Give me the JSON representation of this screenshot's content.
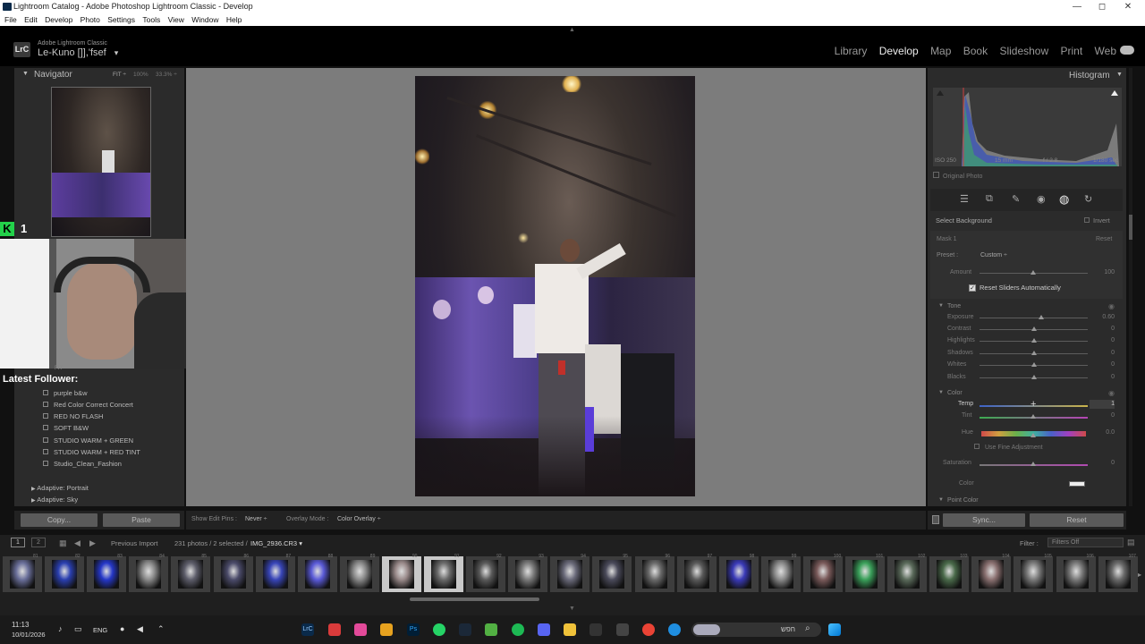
{
  "titlebar": {
    "title": "Lightroom Catalog - Adobe Photoshop Lightroom Classic - Develop",
    "min": "—",
    "max": "◻",
    "close": "✕"
  },
  "menubar": {
    "items": [
      "File",
      "Edit",
      "Develop",
      "Photo",
      "Settings",
      "Tools",
      "View",
      "Window",
      "Help"
    ]
  },
  "identity": {
    "logo": "LrC",
    "brand_top": "Adobe Lightroom Classic",
    "brand_name": "Le-Kuno []],'fsef",
    "dropdown": "▾",
    "modules": [
      "Library",
      "Develop",
      "Map",
      "Book",
      "Slideshow",
      "Print",
      "Web"
    ],
    "active_module": "Develop"
  },
  "navigator": {
    "title": "Navigator",
    "fit": "FIT ÷",
    "zoom1": "100%",
    "zoom2": "33.3% ÷"
  },
  "overlay": {
    "badge_k": "K",
    "badge_num": "1",
    "latest_follower": "Latest Follower:",
    "cut_label": "FIT"
  },
  "presets": {
    "items": [
      "purple b&w",
      "Red Color Correct Concert",
      "RED NO FLASH",
      "SOFT B&W",
      "STUDIO WARM + GREEN",
      "STUDIO WARM + RED TINT",
      "Studio_Clean_Fashion"
    ],
    "groups": [
      "Adaptive: Portrait",
      "Adaptive: Sky"
    ]
  },
  "left_buttons": {
    "copy": "Copy...",
    "paste": "Paste"
  },
  "toolbar": {
    "show_edit_pins_label": "Show Edit Pins :",
    "show_edit_pins_value": "Never ÷",
    "overlay_mode_label": "Overlay Mode :",
    "overlay_mode_value": "Color Overlay ÷"
  },
  "histogram": {
    "title": "Histogram",
    "iso": "ISO 250",
    "focal": "15 mm",
    "aperture": "f / 2.8",
    "shutter": "1/180 sec",
    "original_photo": "Original Photo"
  },
  "mask": {
    "select_label": "Select Background",
    "invert": "Invert",
    "mask_name": "Mask 1",
    "reset": "Reset",
    "preset_label": "Preset :",
    "preset_value": "Custom ÷",
    "amount_label": "Amount",
    "amount_value": "100",
    "reset_sliders": "Reset Sliders Automatically"
  },
  "tone": {
    "title": "Tone",
    "sliders": [
      {
        "label": "Exposure",
        "value": "0.60",
        "pos": 0.57
      },
      {
        "label": "Contrast",
        "value": "0",
        "pos": 0.5
      },
      {
        "label": "Highlights",
        "value": "0",
        "pos": 0.5
      },
      {
        "label": "Shadows",
        "value": "0",
        "pos": 0.5
      },
      {
        "label": "Whites",
        "value": "0",
        "pos": 0.5
      },
      {
        "label": "Blacks",
        "value": "0",
        "pos": 0.5
      }
    ]
  },
  "color": {
    "title": "Color",
    "temp_label": "Temp",
    "temp_value": "1",
    "tint_label": "Tint",
    "tint_value": "0",
    "hue_label": "Hue",
    "hue_value": "0.0",
    "fine": "Use Fine Adjustment",
    "sat_label": "Saturation",
    "sat_value": "0",
    "color_label": "Color"
  },
  "point_color": {
    "title": "Point Color"
  },
  "right_buttons": {
    "sync": "Sync...",
    "reset": "Reset"
  },
  "filmstrip_bar": {
    "page1": "1",
    "page2": "2",
    "source": "Previous Import",
    "count": "231 photos / 2 selected /",
    "file": "IMG_2936.CR3",
    "filter_label": "Filter :",
    "filter_value": "Filters Off"
  },
  "filmstrip_numbers": [
    "81",
    "82",
    "83",
    "84",
    "85",
    "86",
    "87",
    "88",
    "89",
    "90",
    "91",
    "92",
    "93",
    "94",
    "95",
    "96",
    "97",
    "98",
    "99",
    "100",
    "101",
    "102",
    "103",
    "104",
    "105",
    "106",
    "107",
    "108",
    "109"
  ],
  "taskbar": {
    "time": "11:13",
    "date": "10/01/2026",
    "lang": "ENG",
    "search": "חפש"
  },
  "colors": {
    "accent": "#4aa3df",
    "active_module": "#ececec",
    "panel_bg": "#2b2b2b",
    "center_bg": "#7c7c7c"
  }
}
